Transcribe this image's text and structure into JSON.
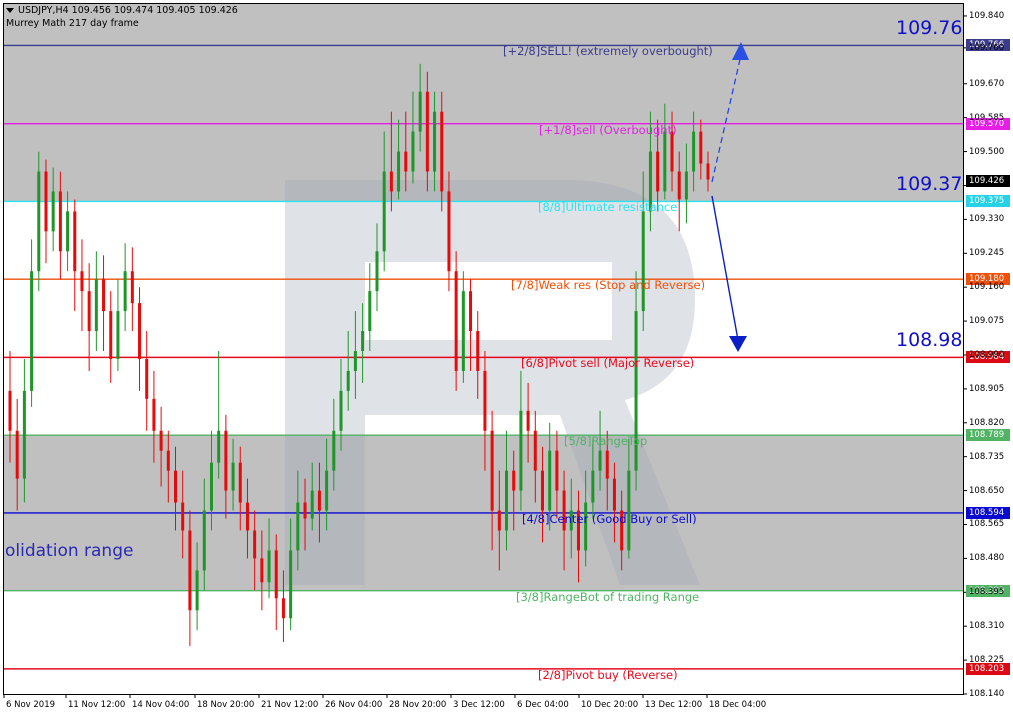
{
  "header": {
    "symbol_line": "USDJPY,H4  109.456 109.474 109.405 109.426",
    "subtitle": "Murrey Math 217 day frame"
  },
  "chart_data": {
    "type": "candlestick",
    "symbol": "USDJPY",
    "timeframe": "H4",
    "ylim": [
      108.14,
      109.87
    ],
    "y_ticks": [
      "109.840",
      "109.760",
      "109.670",
      "109.585",
      "109.500",
      "109.415",
      "109.330",
      "109.245",
      "109.160",
      "109.075",
      "108.990",
      "108.905",
      "108.820",
      "108.735",
      "108.650",
      "108.565",
      "108.480",
      "108.395",
      "108.310",
      "108.225",
      "108.140"
    ],
    "x_ticks": [
      "6 Nov 2019",
      "11 Nov 12:00",
      "14 Nov 04:00",
      "18 Nov 20:00",
      "21 Nov 12:00",
      "26 Nov 04:00",
      "28 Nov 20:00",
      "3 Dec 12:00",
      "6 Dec 04:00",
      "10 Dec 20:00",
      "13 Dec 12:00",
      "18 Dec 04:00"
    ],
    "last_price": 109.426,
    "last_price_label": "109.426",
    "levels": [
      {
        "value": 109.766,
        "price": "109.766",
        "label": "[+2/8]SELL! (extremely overbought)",
        "color": "#3c3c8c",
        "box": "#3c3c8c"
      },
      {
        "value": 109.57,
        "price": "109.570",
        "label": "[+1/8]sell (Overbought)",
        "color": "#e61ee6",
        "box": "#e61ee6"
      },
      {
        "value": 109.375,
        "price": "109.375",
        "label": "[8/8]Ultimate resistance",
        "color": "#28e6f0",
        "box": "#28d2e6"
      },
      {
        "value": 109.18,
        "price": "109.180",
        "label": "[7/8]Weak res (Stop and Reverse)",
        "color": "#f0500a",
        "box": "#f0500a"
      },
      {
        "value": 108.984,
        "price": "108.984",
        "label": "[6/8]Pivot sell (Major Reverse)",
        "color": "#e60a1e",
        "box": "#dc0a14"
      },
      {
        "value": 108.789,
        "price": "108.789",
        "label": "[5/8]RangeTop",
        "color": "#50b464",
        "box": "#50b464"
      },
      {
        "value": 108.594,
        "price": "108.594",
        "label": "[4/8]Center (Good Buy or Sell)",
        "color": "#0a0ad2",
        "box": "#0a0ad2"
      },
      {
        "value": 108.399,
        "price": "108.399",
        "label": "[3/8]RangeBot of trading Range",
        "color": "#50b464",
        "box": "#50b464"
      },
      {
        "value": 108.203,
        "price": "108.203",
        "label": "[2/8]Pivot buy (Reverse)",
        "color": "#e60a1e",
        "box": "#dc0a14"
      }
    ],
    "annotations": {
      "target_high": "109.76",
      "entry": "109.37",
      "target_low": "108.98",
      "consolidation": "olidation range"
    },
    "candles": [
      [
        108.9,
        108.8,
        109.0,
        108.72
      ],
      [
        108.8,
        108.68,
        108.88,
        108.6
      ],
      [
        108.68,
        108.9,
        108.98,
        108.62
      ],
      [
        108.9,
        109.2,
        109.28,
        108.86
      ],
      [
        109.2,
        109.45,
        109.5,
        109.15
      ],
      [
        109.45,
        109.3,
        109.48,
        109.22
      ],
      [
        109.3,
        109.4,
        109.46,
        109.25
      ],
      [
        109.4,
        109.25,
        109.45,
        109.18
      ],
      [
        109.25,
        109.35,
        109.4,
        109.2
      ],
      [
        109.35,
        109.2,
        109.38,
        109.1
      ],
      [
        109.2,
        109.15,
        109.28,
        109.05
      ],
      [
        109.15,
        109.05,
        109.22,
        108.95
      ],
      [
        109.05,
        109.18,
        109.25,
        109.0
      ],
      [
        109.18,
        109.1,
        109.24,
        109.0
      ],
      [
        109.1,
        108.98,
        109.15,
        108.92
      ],
      [
        108.98,
        109.1,
        109.18,
        108.95
      ],
      [
        109.1,
        109.2,
        109.27,
        109.05
      ],
      [
        109.2,
        109.12,
        109.26,
        109.05
      ],
      [
        109.12,
        108.98,
        109.16,
        108.9
      ],
      [
        108.98,
        108.88,
        109.05,
        108.8
      ],
      [
        108.88,
        108.8,
        108.95,
        108.72
      ],
      [
        108.8,
        108.75,
        108.86,
        108.66
      ],
      [
        108.75,
        108.7,
        108.8,
        108.62
      ],
      [
        108.7,
        108.62,
        108.76,
        108.55
      ],
      [
        108.62,
        108.55,
        108.7,
        108.48
      ],
      [
        108.55,
        108.35,
        108.6,
        108.26
      ],
      [
        108.35,
        108.45,
        108.52,
        108.3
      ],
      [
        108.45,
        108.6,
        108.68,
        108.4
      ],
      [
        108.6,
        108.72,
        108.8,
        108.55
      ],
      [
        108.72,
        108.8,
        109.0,
        108.68
      ],
      [
        108.8,
        108.65,
        108.84,
        108.58
      ],
      [
        108.65,
        108.72,
        108.78,
        108.6
      ],
      [
        108.72,
        108.62,
        108.76,
        108.55
      ],
      [
        108.62,
        108.55,
        108.68,
        108.48
      ],
      [
        108.55,
        108.48,
        108.6,
        108.4
      ],
      [
        108.48,
        108.42,
        108.55,
        108.35
      ],
      [
        108.42,
        108.5,
        108.58,
        108.38
      ],
      [
        108.5,
        108.38,
        108.54,
        108.3
      ],
      [
        108.38,
        108.33,
        108.45,
        108.27
      ],
      [
        108.33,
        108.5,
        108.58,
        108.3
      ],
      [
        108.5,
        108.62,
        108.7,
        108.45
      ],
      [
        108.62,
        108.58,
        108.68,
        108.5
      ],
      [
        108.58,
        108.65,
        108.72,
        108.55
      ],
      [
        108.65,
        108.6,
        108.72,
        108.52
      ],
      [
        108.6,
        108.7,
        108.78,
        108.55
      ],
      [
        108.7,
        108.8,
        108.88,
        108.65
      ],
      [
        108.8,
        108.9,
        108.98,
        108.75
      ],
      [
        108.9,
        108.95,
        109.05,
        108.85
      ],
      [
        108.95,
        109.0,
        109.1,
        108.88
      ],
      [
        109.0,
        109.05,
        109.12,
        108.92
      ],
      [
        109.05,
        109.15,
        109.22,
        109.0
      ],
      [
        109.15,
        109.25,
        109.32,
        109.1
      ],
      [
        109.25,
        109.45,
        109.55,
        109.2
      ],
      [
        109.45,
        109.4,
        109.6,
        109.35
      ],
      [
        109.4,
        109.5,
        109.58,
        109.38
      ],
      [
        109.5,
        109.45,
        109.6,
        109.4
      ],
      [
        109.45,
        109.55,
        109.65,
        109.42
      ],
      [
        109.55,
        109.65,
        109.72,
        109.5
      ],
      [
        109.65,
        109.45,
        109.7,
        109.4
      ],
      [
        109.45,
        109.6,
        109.65,
        109.4
      ],
      [
        109.6,
        109.4,
        109.65,
        109.35
      ],
      [
        109.4,
        109.2,
        109.45,
        109.15
      ],
      [
        109.2,
        108.95,
        109.25,
        108.9
      ],
      [
        108.95,
        109.15,
        109.2,
        108.92
      ],
      [
        109.15,
        109.05,
        109.18,
        108.95
      ],
      [
        109.05,
        108.95,
        109.1,
        108.88
      ],
      [
        108.95,
        108.8,
        109.0,
        108.7
      ],
      [
        108.8,
        108.6,
        108.85,
        108.5
      ],
      [
        108.6,
        108.55,
        108.7,
        108.45
      ],
      [
        108.55,
        108.7,
        108.8,
        108.5
      ],
      [
        108.7,
        108.65,
        108.75,
        108.55
      ],
      [
        108.65,
        108.85,
        108.95,
        108.6
      ],
      [
        108.85,
        108.8,
        108.92,
        108.72
      ],
      [
        108.8,
        108.7,
        108.85,
        108.62
      ],
      [
        108.7,
        108.6,
        108.76,
        108.52
      ],
      [
        108.6,
        108.75,
        108.82,
        108.55
      ],
      [
        108.75,
        108.65,
        108.8,
        108.58
      ],
      [
        108.65,
        108.55,
        108.7,
        108.45
      ],
      [
        108.55,
        108.6,
        108.68,
        108.48
      ],
      [
        108.6,
        108.5,
        108.65,
        108.42
      ],
      [
        108.5,
        108.62,
        108.7,
        108.46
      ],
      [
        108.62,
        108.7,
        108.78,
        108.58
      ],
      [
        108.7,
        108.75,
        108.85,
        108.65
      ],
      [
        108.75,
        108.68,
        108.8,
        108.6
      ],
      [
        108.68,
        108.6,
        108.72,
        108.52
      ],
      [
        108.6,
        108.5,
        108.65,
        108.45
      ],
      [
        108.5,
        108.7,
        108.78,
        108.48
      ],
      [
        108.7,
        109.1,
        109.2,
        108.65
      ],
      [
        109.1,
        109.35,
        109.45,
        109.05
      ],
      [
        109.35,
        109.5,
        109.6,
        109.3
      ],
      [
        109.5,
        109.4,
        109.58,
        109.35
      ],
      [
        109.4,
        109.55,
        109.62,
        109.38
      ],
      [
        109.55,
        109.45,
        109.6,
        109.4
      ],
      [
        109.45,
        109.38,
        109.5,
        109.3
      ],
      [
        109.38,
        109.45,
        109.52,
        109.32
      ],
      [
        109.45,
        109.55,
        109.6,
        109.4
      ],
      [
        109.55,
        109.47,
        109.58,
        109.43
      ],
      [
        109.47,
        109.43,
        109.5,
        109.4
      ]
    ]
  }
}
